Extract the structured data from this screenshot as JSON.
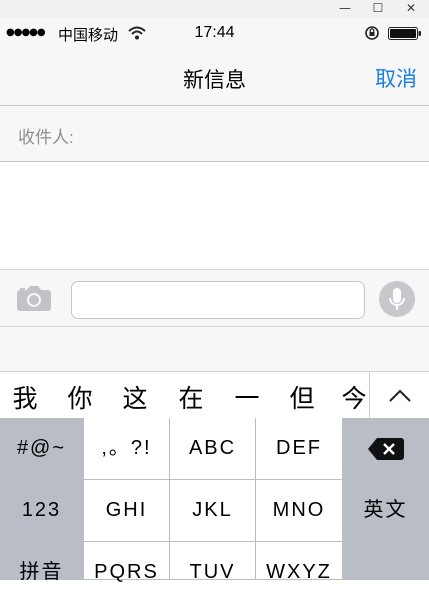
{
  "status": {
    "signal": "●●●●●",
    "carrier": "中国移动",
    "time": "17:44"
  },
  "nav": {
    "title": "新信息",
    "cancel": "取消"
  },
  "recipient": {
    "label": "收件人:"
  },
  "candidates": [
    "我",
    "你",
    "这",
    "在",
    "一",
    "但",
    "今"
  ],
  "keyboard": {
    "row1": [
      "#@~",
      ",。?!",
      "ABC",
      "DEF"
    ],
    "row2": [
      "123",
      "GHI",
      "JKL",
      "MNO",
      "英文"
    ],
    "row3": [
      "拼音",
      "PQRS",
      "TUV",
      "WXYZ"
    ]
  },
  "colors": {
    "accent": "#1a7fe0",
    "bar_bg": "#f7f7f7",
    "key_dark": "#b8bdc6"
  }
}
